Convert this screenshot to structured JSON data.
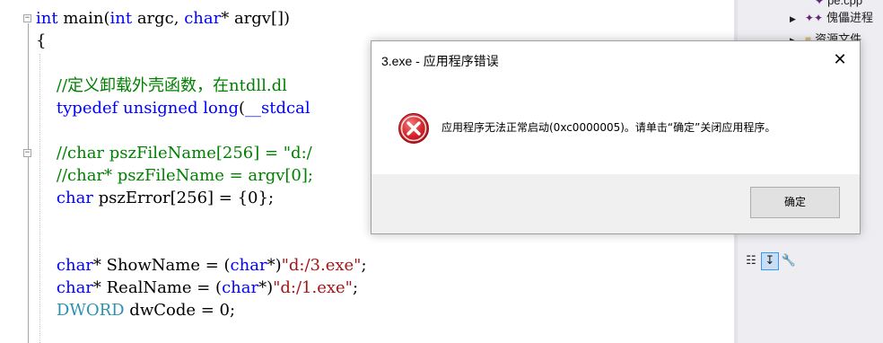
{
  "editor": {
    "lines": [
      [
        {
          "t": "int",
          "c": "kw"
        },
        {
          "t": " main("
        },
        {
          "t": "int",
          "c": "kw"
        },
        {
          "t": " argc, "
        },
        {
          "t": "char",
          "c": "kw"
        },
        {
          "t": "* argv[])"
        }
      ],
      [
        {
          "t": "{"
        }
      ],
      [],
      [
        {
          "t": "    //定义卸载外壳函数，在ntdll.dl",
          "c": "cm"
        }
      ],
      [
        {
          "t": "    "
        },
        {
          "t": "typedef",
          "c": "kw"
        },
        {
          "t": " "
        },
        {
          "t": "unsigned",
          "c": "kw"
        },
        {
          "t": " "
        },
        {
          "t": "long",
          "c": "kw"
        },
        {
          "t": "("
        },
        {
          "t": "__stdcal",
          "c": "kw"
        }
      ],
      [],
      [
        {
          "t": "    //char pszFileName[256] = \"d:/",
          "c": "cm"
        }
      ],
      [
        {
          "t": "    //char* pszFileName = argv[0];",
          "c": "cm"
        }
      ],
      [
        {
          "t": "    "
        },
        {
          "t": "char",
          "c": "kw"
        },
        {
          "t": " pszError[256] = {0};"
        }
      ],
      [],
      [],
      [
        {
          "t": "    "
        },
        {
          "t": "char",
          "c": "kw"
        },
        {
          "t": "* ShowName = ("
        },
        {
          "t": "char",
          "c": "kw"
        },
        {
          "t": "*)"
        },
        {
          "t": "\"d:/3.exe\"",
          "c": "str"
        },
        {
          "t": ";"
        }
      ],
      [
        {
          "t": "    "
        },
        {
          "t": "char",
          "c": "kw"
        },
        {
          "t": "* RealName = ("
        },
        {
          "t": "char",
          "c": "kw"
        },
        {
          "t": "*)"
        },
        {
          "t": "\"d:/1.exe\"",
          "c": "str"
        },
        {
          "t": ";"
        }
      ],
      [
        {
          "t": "    "
        },
        {
          "t": "DWORD",
          "c": "ty"
        },
        {
          "t": " dwCode = 0;"
        }
      ]
    ]
  },
  "solution_explorer": {
    "items": [
      {
        "label": "pe.cpp",
        "icon": "cpp-file-icon"
      },
      {
        "label": "傀儡进程",
        "icon": "project-icon"
      },
      {
        "label": "资源文件",
        "icon": "folder-icon"
      }
    ],
    "toolbar": [
      {
        "name": "categorized-icon",
        "glyph": "☷"
      },
      {
        "name": "alphabetical-icon",
        "glyph": "↧"
      },
      {
        "name": "property-pages-icon",
        "glyph": "🔧"
      }
    ]
  },
  "dialog": {
    "title": "3.exe - 应用程序错误",
    "message": "应用程序无法正常启动(0xc0000005)。请单击“确定”关闭应用程序。",
    "ok_label": "确定",
    "close_glyph": "✕",
    "error_color": "#d2232a"
  },
  "colors": {
    "keyword": "#0000ff",
    "comment": "#008000",
    "string": "#a31515",
    "type": "#2b91af"
  }
}
